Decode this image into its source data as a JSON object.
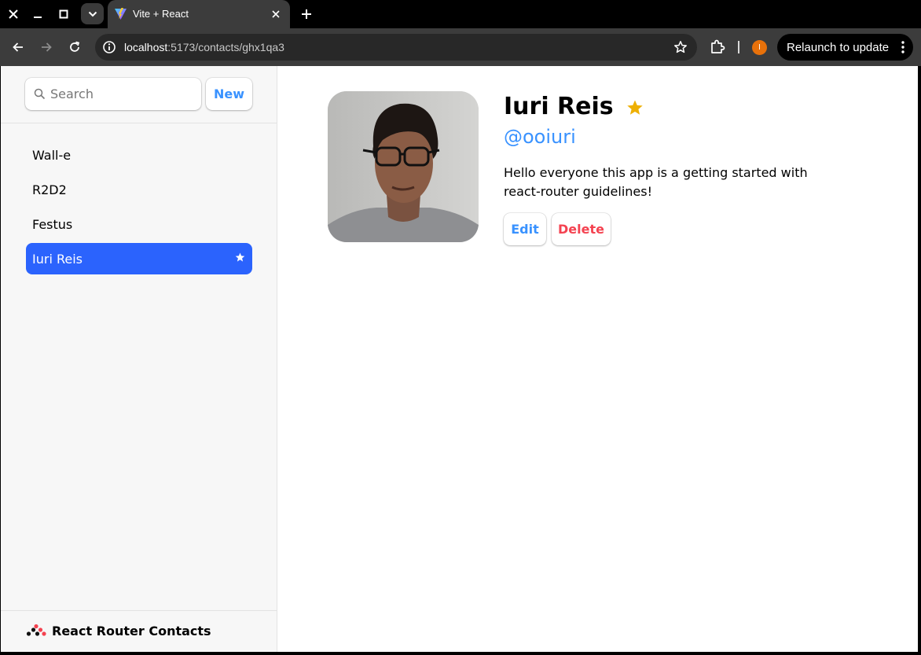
{
  "browser": {
    "tab_title": "Vite + React",
    "url_host": "localhost",
    "url_path": ":5173/contacts/ghx1qa3",
    "profile_initial": "I",
    "relaunch_label": "Relaunch to update",
    "icons": {
      "close": "close-icon",
      "minimize": "minimize-icon",
      "maximize": "maximize-icon",
      "tab_search": "chevron-down-icon",
      "new_tab": "plus-icon",
      "back": "arrow-left-icon",
      "forward": "arrow-right-icon",
      "reload": "reload-icon",
      "site_info": "info-icon",
      "bookmark": "star-outline-icon",
      "extensions": "puzzle-icon",
      "menu": "more-vertical-icon"
    },
    "colors": {
      "frame": "#000000",
      "toolbar": "#3c3c3c",
      "omnibox": "#282828",
      "profile": "#e8710a"
    }
  },
  "sidebar": {
    "search_placeholder": "Search",
    "new_label": "New",
    "contacts": [
      {
        "name": "Wall-e",
        "favorite": false,
        "active": false
      },
      {
        "name": "R2D2",
        "favorite": false,
        "active": false
      },
      {
        "name": "Festus",
        "favorite": false,
        "active": false
      },
      {
        "name": "Iuri Reis",
        "favorite": true,
        "active": true
      }
    ],
    "active_star": "★",
    "footer_title": "React Router Contacts"
  },
  "contact": {
    "name": "Iuri Reis",
    "handle": "@ooiuri",
    "notes": "Hello everyone this app is a getting started with react-router guidelines!",
    "favorite": true,
    "fav_star": "★",
    "edit_label": "Edit",
    "delete_label": "Delete"
  },
  "colors": {
    "accent": "#3992ff",
    "active_item": "#2b65fb",
    "danger": "#f44250",
    "favorite_star": "#eeb004"
  }
}
